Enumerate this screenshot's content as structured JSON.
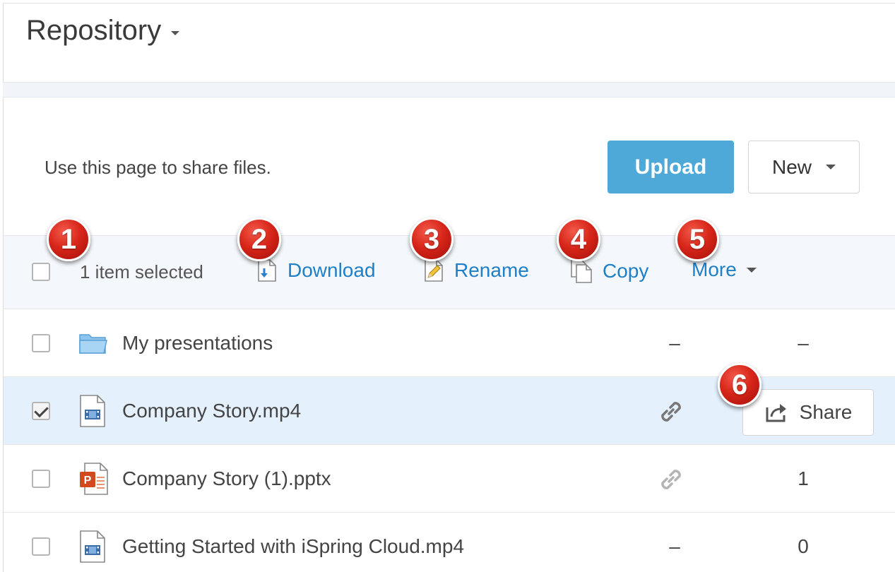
{
  "header": {
    "title": "Repository"
  },
  "intro": {
    "text": "Use this page to share files."
  },
  "buttons": {
    "upload": "Upload",
    "new": "New"
  },
  "toolbar": {
    "selection_text": "1 item selected",
    "actions": [
      {
        "label": "Download",
        "icon": "download-icon"
      },
      {
        "label": "Rename",
        "icon": "pencil-icon"
      },
      {
        "label": "Copy",
        "icon": "copy-icon"
      },
      {
        "label": "More",
        "icon": "chevron-down-icon"
      }
    ]
  },
  "badges": [
    "1",
    "2",
    "3",
    "4",
    "5",
    "6"
  ],
  "files": [
    {
      "name": "My presentations",
      "type": "folder",
      "col1": "–",
      "col2": "–",
      "checked": false
    },
    {
      "name": "Company Story.mp4",
      "type": "video",
      "col1": "",
      "col2": "",
      "checked": true,
      "share_label": "Share"
    },
    {
      "name": "Company Story (1).pptx",
      "type": "pptx",
      "col1": "",
      "col2": "1",
      "checked": false
    },
    {
      "name": "Getting Started with iSpring Cloud.mp4",
      "type": "video",
      "col1": "–",
      "col2": "0",
      "checked": false
    }
  ],
  "colors": {
    "accent": "#1f7fc7",
    "upload": "#4ea9d8",
    "selected_row": "#e4f1fd",
    "badge": "#d8261a"
  }
}
